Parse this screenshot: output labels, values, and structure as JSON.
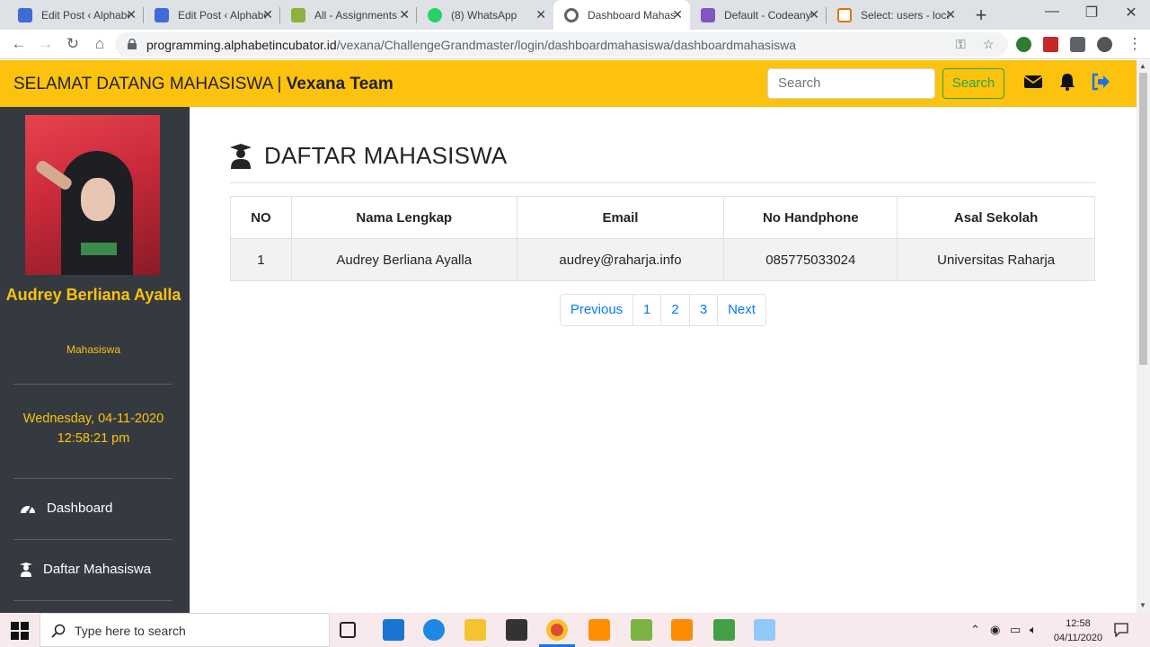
{
  "browser": {
    "tabs": [
      {
        "title": "Edit Post ‹ Alphabet",
        "color": "#3f6ad8"
      },
      {
        "title": "Edit Post ‹ Alphabet",
        "color": "#3f6ad8"
      },
      {
        "title": "All - Assignments",
        "color": "#8bb23c"
      },
      {
        "title": "(8) WhatsApp",
        "color": "#25d366"
      },
      {
        "title": "Dashboard Mahasiswa",
        "color": "#5f6368"
      },
      {
        "title": "Default - Codeanywhere",
        "color": "#7e57c2"
      },
      {
        "title": "Select: users - localhost",
        "color": "#e37400"
      }
    ],
    "url_host": "programming.alphabetincubator.id",
    "url_path": "/vexana/ChallengeGrandmaster/login/dashboardmahasiswa/dashboardmahasiswa"
  },
  "header": {
    "welcome": "SELAMAT DATANG MAHASISWA | ",
    "team": "Vexana Team",
    "search_placeholder": "Search",
    "search_button": "Search"
  },
  "sidebar": {
    "name": "Audrey Berliana Ayalla",
    "role": "Mahasiswa",
    "date": "Wednesday, 04-11-2020",
    "time": "12:58:21 pm",
    "nav": [
      {
        "label": "Dashboard"
      },
      {
        "label": "Daftar Mahasiswa"
      }
    ]
  },
  "main": {
    "title": "DAFTAR MAHASISWA",
    "columns": [
      "NO",
      "Nama Lengkap",
      "Email",
      "No Handphone",
      "Asal Sekolah"
    ],
    "rows": [
      [
        "1",
        "Audrey Berliana Ayalla",
        "audrey@raharja.info",
        "085775033024",
        "Universitas Raharja"
      ]
    ],
    "pagination": [
      "Previous",
      "1",
      "2",
      "3",
      "Next"
    ]
  },
  "taskbar": {
    "search_placeholder": "Type here to search",
    "time": "12:58",
    "date": "04/11/2020"
  }
}
